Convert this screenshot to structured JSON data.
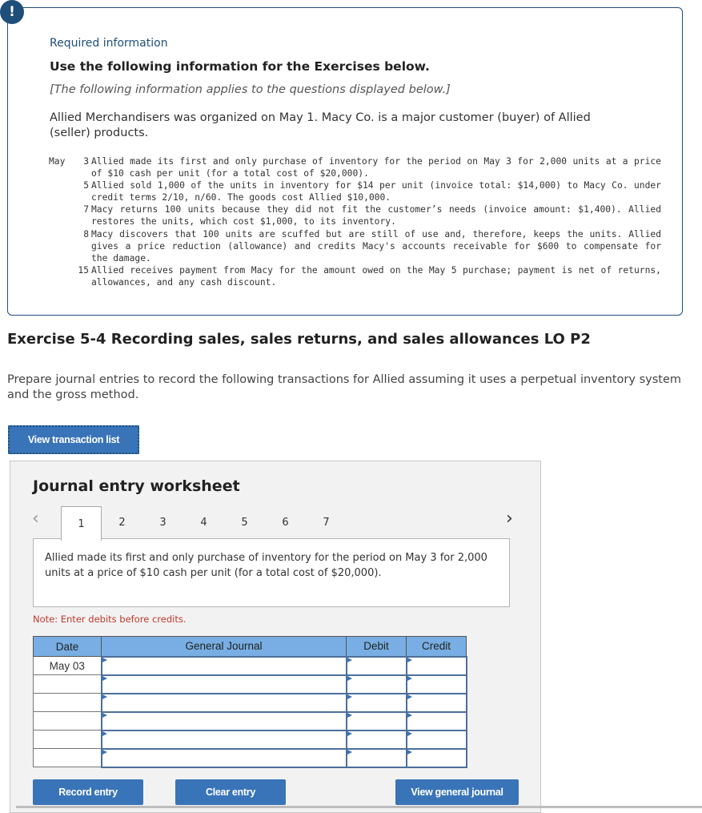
{
  "info_box": {
    "icon": "exclamation-icon",
    "required_label": "Required information",
    "use_title": "Use the following information for the Exercises below.",
    "applies_note": "[The following information applies to the questions displayed below.]",
    "intro": "Allied Merchandisers was organized on May 1. Macy Co. is a major customer (buyer) of Allied (seller) products.",
    "transactions": [
      {
        "month": "May",
        "day": "3",
        "text": "Allied made its first and only purchase of inventory for the period on May 3 for 2,000 units at a price of $10 cash per unit (for a total cost of $20,000)."
      },
      {
        "month": "",
        "day": "5",
        "text": "Allied sold 1,000 of the units in inventory for $14 per unit (invoice total: $14,000) to Macy Co. under credit terms 2/10, n/60. The goods cost Allied $10,000."
      },
      {
        "month": "",
        "day": "7",
        "text": "Macy returns 100 units because they did not fit the customer’s needs (invoice amount: $1,400). Allied restores the units, which cost $1,000, to its inventory."
      },
      {
        "month": "",
        "day": "8",
        "text": "Macy discovers that 100 units are scuffed but are still of use and, therefore, keeps the units. Allied gives a price reduction (allowance) and credits Macy's accounts receivable for $600 to compensate for the damage."
      },
      {
        "month": "",
        "day": "15",
        "text": "Allied receives payment from Macy for the amount owed on the May 5 purchase; payment is net of returns, allowances, and any cash discount."
      }
    ]
  },
  "exercise": {
    "title": "Exercise 5-4 Recording sales, sales returns, and sales allowances LO P2",
    "instructions": "Prepare journal entries to record the following transactions for Allied assuming it uses a perpetual inventory system and the gross method.",
    "view_transaction_list_label": "View transaction list"
  },
  "worksheet": {
    "title": "Journal entry worksheet",
    "prev_icon": "chevron-left-icon",
    "next_icon": "chevron-right-icon",
    "tabs": [
      "1",
      "2",
      "3",
      "4",
      "5",
      "6",
      "7"
    ],
    "active_tab": "1",
    "description": "Allied made its first and only purchase of inventory for the period on May 3 for 2,000 units at a price of $10 cash per unit (for a total cost of $20,000).",
    "note": "Note: Enter debits before credits.",
    "columns": [
      "Date",
      "General Journal",
      "Debit",
      "Credit"
    ],
    "rows": [
      {
        "date": "May 03",
        "account": "",
        "debit": "",
        "credit": ""
      },
      {
        "date": "",
        "account": "",
        "debit": "",
        "credit": ""
      },
      {
        "date": "",
        "account": "",
        "debit": "",
        "credit": ""
      },
      {
        "date": "",
        "account": "",
        "debit": "",
        "credit": ""
      },
      {
        "date": "",
        "account": "",
        "debit": "",
        "credit": ""
      },
      {
        "date": "",
        "account": "",
        "debit": "",
        "credit": ""
      }
    ],
    "buttons": {
      "record": "Record entry",
      "clear": "Clear entry",
      "view_general_journal": "View general journal"
    }
  },
  "colors": {
    "brand_navy": "#1f4e79",
    "button_blue": "#3a74b8",
    "header_blue": "#78aee3",
    "note_red": "#c0392b"
  }
}
